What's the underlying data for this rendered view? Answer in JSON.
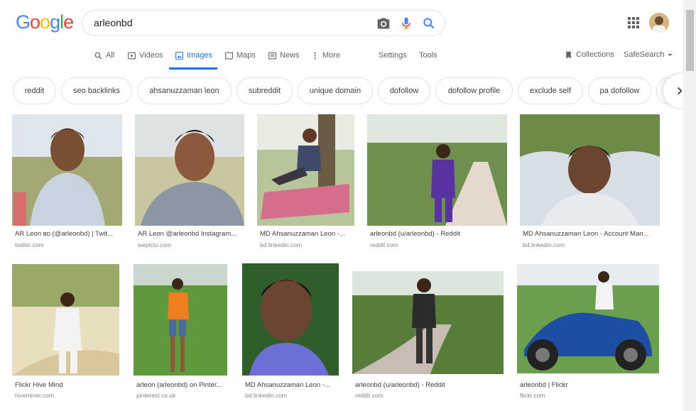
{
  "logo": {
    "letters": [
      "G",
      "o",
      "o",
      "g",
      "l",
      "e"
    ],
    "colors": [
      "#4285f4",
      "#ea4335",
      "#fbbc05",
      "#4285f4",
      "#34a853",
      "#ea4335"
    ]
  },
  "search": {
    "value": "arleonbd"
  },
  "tabs": {
    "all": "All",
    "videos": "Videos",
    "images": "Images",
    "maps": "Maps",
    "news": "News",
    "more": "More",
    "settings": "Settings",
    "tools": "Tools",
    "collections": "Collections",
    "safesearch": "SafeSearch"
  },
  "chips": [
    "reddit",
    "seo backlinks",
    "ahsanuzzaman leon",
    "subreddit",
    "unique domain",
    "dofollow",
    "dofollow profile",
    "exclude self",
    "pa dofollow"
  ],
  "results": [
    {
      "caption": "AR Leon ʙᴅ (@arleonbd) | Twit...",
      "source": "twitter.com"
    },
    {
      "caption": "AR Leon @arleonbd Instagram...",
      "source": "wepictu.com"
    },
    {
      "caption": "MD Ahsanuzzaman Leon -...",
      "source": "bd.linkedin.com"
    },
    {
      "caption": "arleonbd (u/arleonbd) - Reddit",
      "source": "reddit.com"
    },
    {
      "caption": "MD Ahsanuzzaman Leon - Account Man...",
      "source": "bd.linkedin.com"
    },
    {
      "caption": "Flickr Hive Mind",
      "source": "hiveminer.com"
    },
    {
      "caption": "arleon (arleonbd) on Pinter...",
      "source": "pinterest.co.uk"
    },
    {
      "caption": "MD Ahsanuzzaman Leon -...",
      "source": "bd.linkedin.com"
    },
    {
      "caption": "arleonbd (u/arleonbd) - Reddit",
      "source": "reddit.com"
    },
    {
      "caption": "arleonbd | Flickr",
      "source": "flickr.com"
    }
  ],
  "colors": {
    "accent": "#1a73e8",
    "border": "#dfe1e5",
    "muted": "#5f6368"
  }
}
